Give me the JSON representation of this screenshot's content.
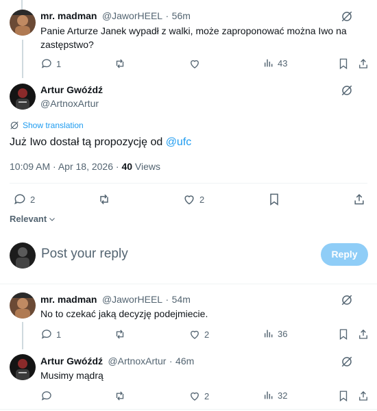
{
  "colors": {
    "accent": "#1d9bf0",
    "text": "#0f1419",
    "muted": "#536471",
    "reply_button_bg": "#8fcdf7",
    "divider": "#eff3f4"
  },
  "reply1": {
    "name": "mr. madman",
    "handle": "@JaworHEEL",
    "dot": "·",
    "time": "56m",
    "text": "Panie Arturze Janek wypadł z walki, może zaproponować można Iwo na zastępstwo?",
    "replies": "1",
    "views": "43",
    "avatar_icon": "fighter-avatar-icon"
  },
  "main_post": {
    "name": "Artur Gwóźdź",
    "handle": "@ArtnoxArtur",
    "show_translation": "Show translation",
    "text_prefix": "Już Iwo dostał tą propozycję od ",
    "mention": "@ufc",
    "timestamp": "10:09 AM · Apr 18, 2026 · ",
    "views_count": "40",
    "views_label": " Views",
    "replies": "2",
    "likes": "2",
    "avatar_icon": "fighter-avatar-icon"
  },
  "sort": {
    "label": "Relevant"
  },
  "compose": {
    "placeholder": "Post your reply",
    "button_label": "Reply"
  },
  "reply2": {
    "name": "mr. madman",
    "handle": "@JaworHEEL",
    "dot": "·",
    "time": "54m",
    "text": "No to czekać jaką decyzję podejmiecie.",
    "replies": "1",
    "likes": "2",
    "views": "36"
  },
  "reply3": {
    "name": "Artur Gwóźdź",
    "handle": "@ArtnoxArtur",
    "dot": "·",
    "time": "46m",
    "text": "Musimy mądrą",
    "likes": "2",
    "views": "32"
  }
}
